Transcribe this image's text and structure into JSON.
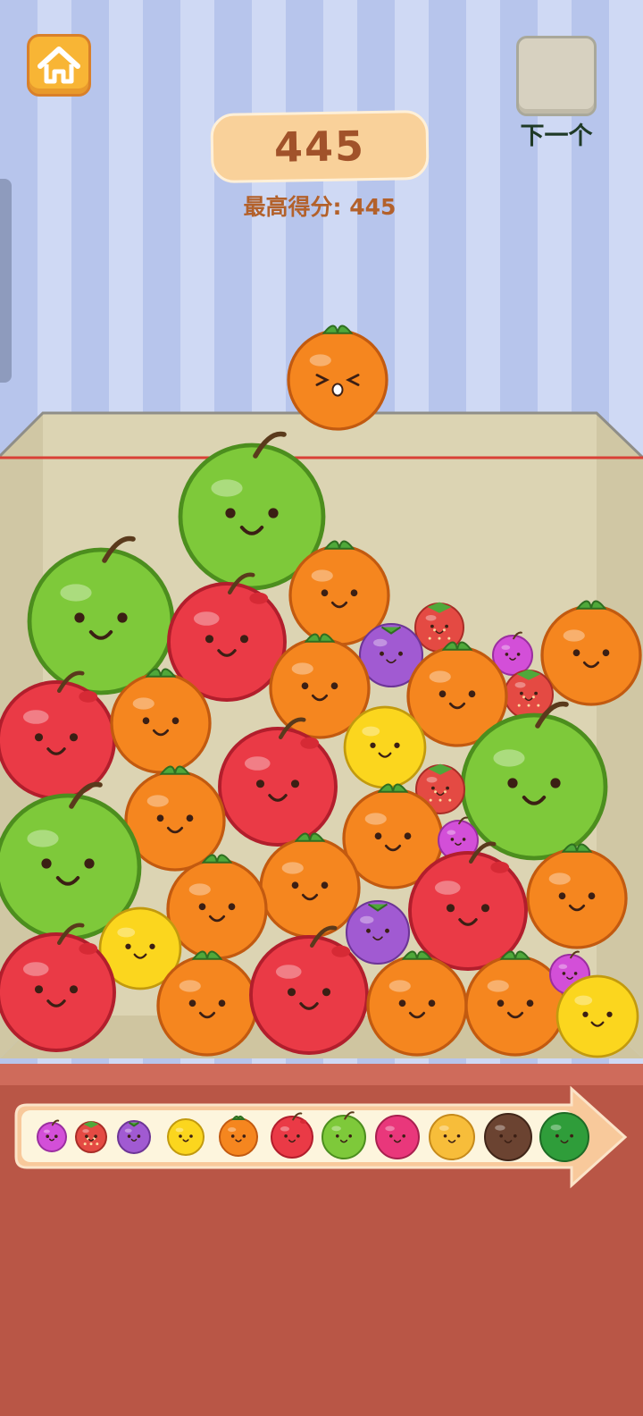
{
  "score": {
    "current": "445",
    "best_label": "最高得分: 445"
  },
  "next": {
    "label": "下一个"
  },
  "buttons": {
    "home": "home-icon"
  },
  "colors": {
    "wall_light": "#cfd9f4",
    "wall_dark": "#b7c5ec",
    "box_back": "#dcd4b3",
    "box_side": "#d0c7a4",
    "box_rim": "#e3dcc0",
    "danger_line": "#d94036",
    "floor": "#b95646",
    "floor_top": "#cf6b5b",
    "score_pill": "#f9d19a",
    "score_text": "#a1522a",
    "orange": "#f5861f",
    "red_apple": "#ea3a46",
    "green_apple": "#7ec93a",
    "lemon": "#fbd61e",
    "grape": "#a15ad2",
    "cherry": "#d34fd8",
    "strawberry": "#e44a43"
  },
  "dropping_fruit": {
    "type": "orange",
    "expression": "squint"
  },
  "fruits_in_box": [
    {
      "type": "green_apple"
    },
    {
      "type": "orange"
    },
    {
      "type": "green_apple"
    },
    {
      "type": "red_apple"
    },
    {
      "type": "strawberry"
    },
    {
      "type": "grape"
    },
    {
      "type": "cherry"
    },
    {
      "type": "orange"
    },
    {
      "type": "red_apple"
    },
    {
      "type": "orange"
    },
    {
      "type": "orange"
    },
    {
      "type": "strawberry"
    },
    {
      "type": "orange"
    },
    {
      "type": "lemon"
    },
    {
      "type": "red_apple"
    },
    {
      "type": "orange"
    },
    {
      "type": "green_apple"
    },
    {
      "type": "strawberry"
    },
    {
      "type": "orange"
    },
    {
      "type": "cherry"
    },
    {
      "type": "green_apple"
    },
    {
      "type": "orange"
    },
    {
      "type": "orange"
    },
    {
      "type": "red_apple"
    },
    {
      "type": "orange"
    },
    {
      "type": "grape"
    },
    {
      "type": "lemon"
    },
    {
      "type": "red_apple"
    },
    {
      "type": "orange"
    },
    {
      "type": "red_apple"
    },
    {
      "type": "orange"
    },
    {
      "type": "orange"
    },
    {
      "type": "cherry"
    },
    {
      "type": "lemon"
    }
  ],
  "evolution_chain": [
    "cherry",
    "strawberry",
    "grape",
    "lemon",
    "orange",
    "red_apple",
    "green_apple",
    "dragon_fruit",
    "pineapple",
    "coconut",
    "watermelon"
  ]
}
